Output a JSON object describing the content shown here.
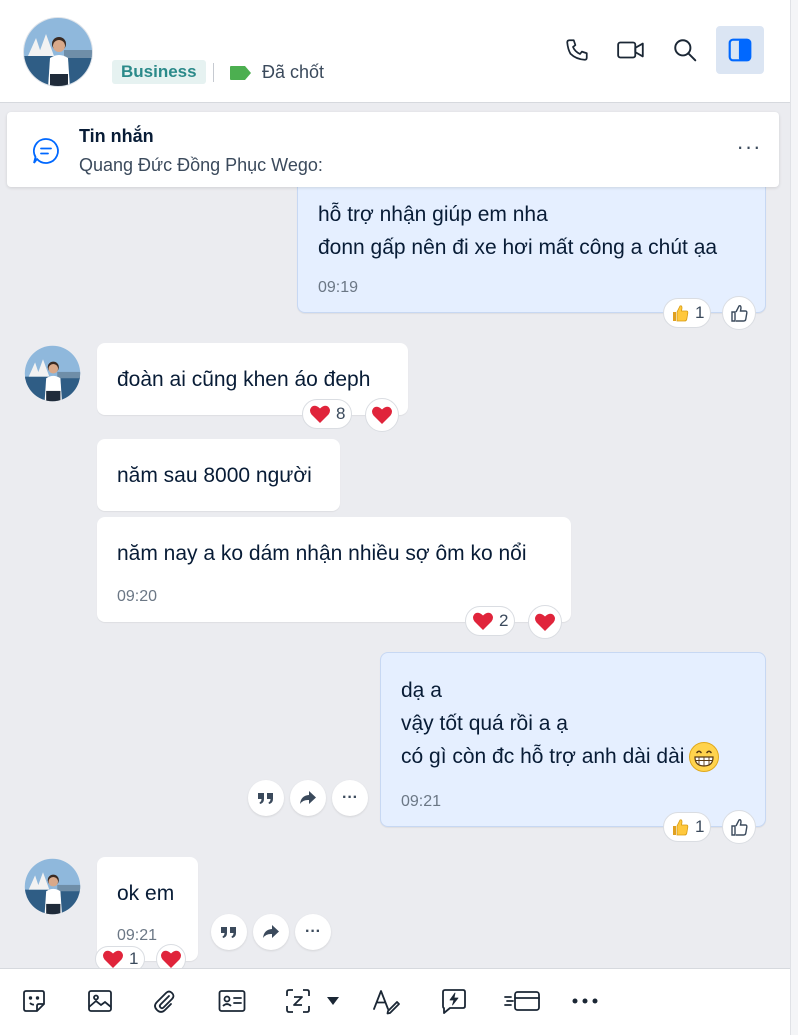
{
  "header": {
    "tag_business": "Business",
    "tag_label": "Đã chốt",
    "tag_color": "#4caf50",
    "icons": [
      "phone-icon",
      "video-call-icon",
      "search-icon",
      "sidebar-toggle-icon"
    ]
  },
  "pinned": {
    "title": "Tin nhắn",
    "subtitle": "Quang Đức Đồng Phục Wego:",
    "more": "···"
  },
  "messages": {
    "m1": {
      "lines": [
        "hỗ trợ nhận giúp em nha",
        "đonn gấp nên đi xe hơi mất công a chút ạa"
      ],
      "time": "09:19",
      "reaction_count": "1"
    },
    "m2": {
      "text": "đoàn ai cũng khen áo đeph",
      "reaction_count": "8"
    },
    "m3": {
      "text": "năm sau 8000 người"
    },
    "m4": {
      "text": "năm nay a ko dám nhận nhiều sợ ôm ko nổi",
      "time": "09:20",
      "reaction_count": "2"
    },
    "m5": {
      "lines": [
        "dạ a",
        "vậy tốt quá rồi a ạ",
        "có gì còn đc hỗ trợ anh dài dài"
      ],
      "time": "09:21",
      "reaction_count": "1"
    },
    "m6": {
      "text": "ok em",
      "time": "09:21",
      "reaction_count": "1"
    }
  },
  "actions": {
    "more": "···"
  },
  "colors": {
    "accent": "#0068ff",
    "bubble_out": "#e5efff",
    "bubble_in": "#ffffff",
    "heart": "#e0243b"
  },
  "toolbar_icons": [
    "sticker-icon",
    "image-icon",
    "attachment-icon",
    "contact-card-icon",
    "screenshot-icon",
    "dropdown-icon",
    "format-text-icon",
    "quick-message-icon",
    "payment-card-icon",
    "more-icon"
  ]
}
